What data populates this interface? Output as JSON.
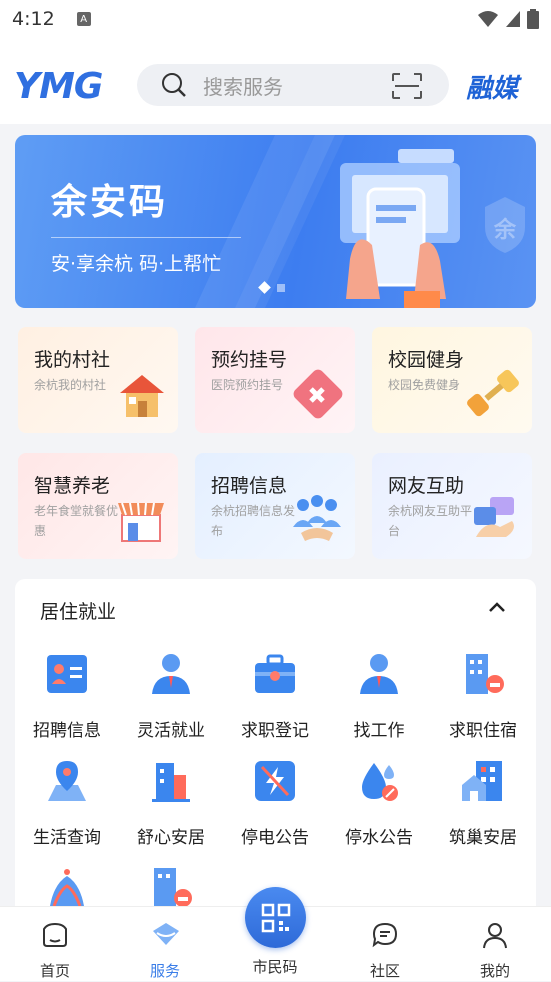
{
  "status_bar": {
    "time": "4:12",
    "a_badge": "A"
  },
  "header": {
    "logo": "YMG",
    "search_placeholder": "搜索服务",
    "brand": "融媒"
  },
  "banner": {
    "title": "余安码",
    "subtitle": "安·享余杭 码·上帮忙",
    "shield_text": "余"
  },
  "cards": [
    {
      "title": "我的村社",
      "sub": "余杭我的村社"
    },
    {
      "title": "预约挂号",
      "sub": "医院预约挂号"
    },
    {
      "title": "校园健身",
      "sub": "校园免费健身"
    },
    {
      "title": "智慧养老",
      "sub": "老年食堂就餐优惠"
    },
    {
      "title": "招聘信息",
      "sub": "余杭招聘信息发布"
    },
    {
      "title": "网友互助",
      "sub": "余杭网友互助平台"
    }
  ],
  "section": {
    "title": "居住就业",
    "items": [
      {
        "label": "招聘信息"
      },
      {
        "label": "灵活就业"
      },
      {
        "label": "求职登记"
      },
      {
        "label": "找工作"
      },
      {
        "label": "求职住宿"
      },
      {
        "label": "生活查询"
      },
      {
        "label": "舒心安居"
      },
      {
        "label": "停电公告"
      },
      {
        "label": "停水公告"
      },
      {
        "label": "筑巢安居"
      }
    ]
  },
  "tabbar": {
    "home": "首页",
    "service": "服务",
    "citizen_code": "市民码",
    "community": "社区",
    "mine": "我的"
  },
  "colors": {
    "accent": "#3b7ee8",
    "banner": "#3d7df0"
  }
}
